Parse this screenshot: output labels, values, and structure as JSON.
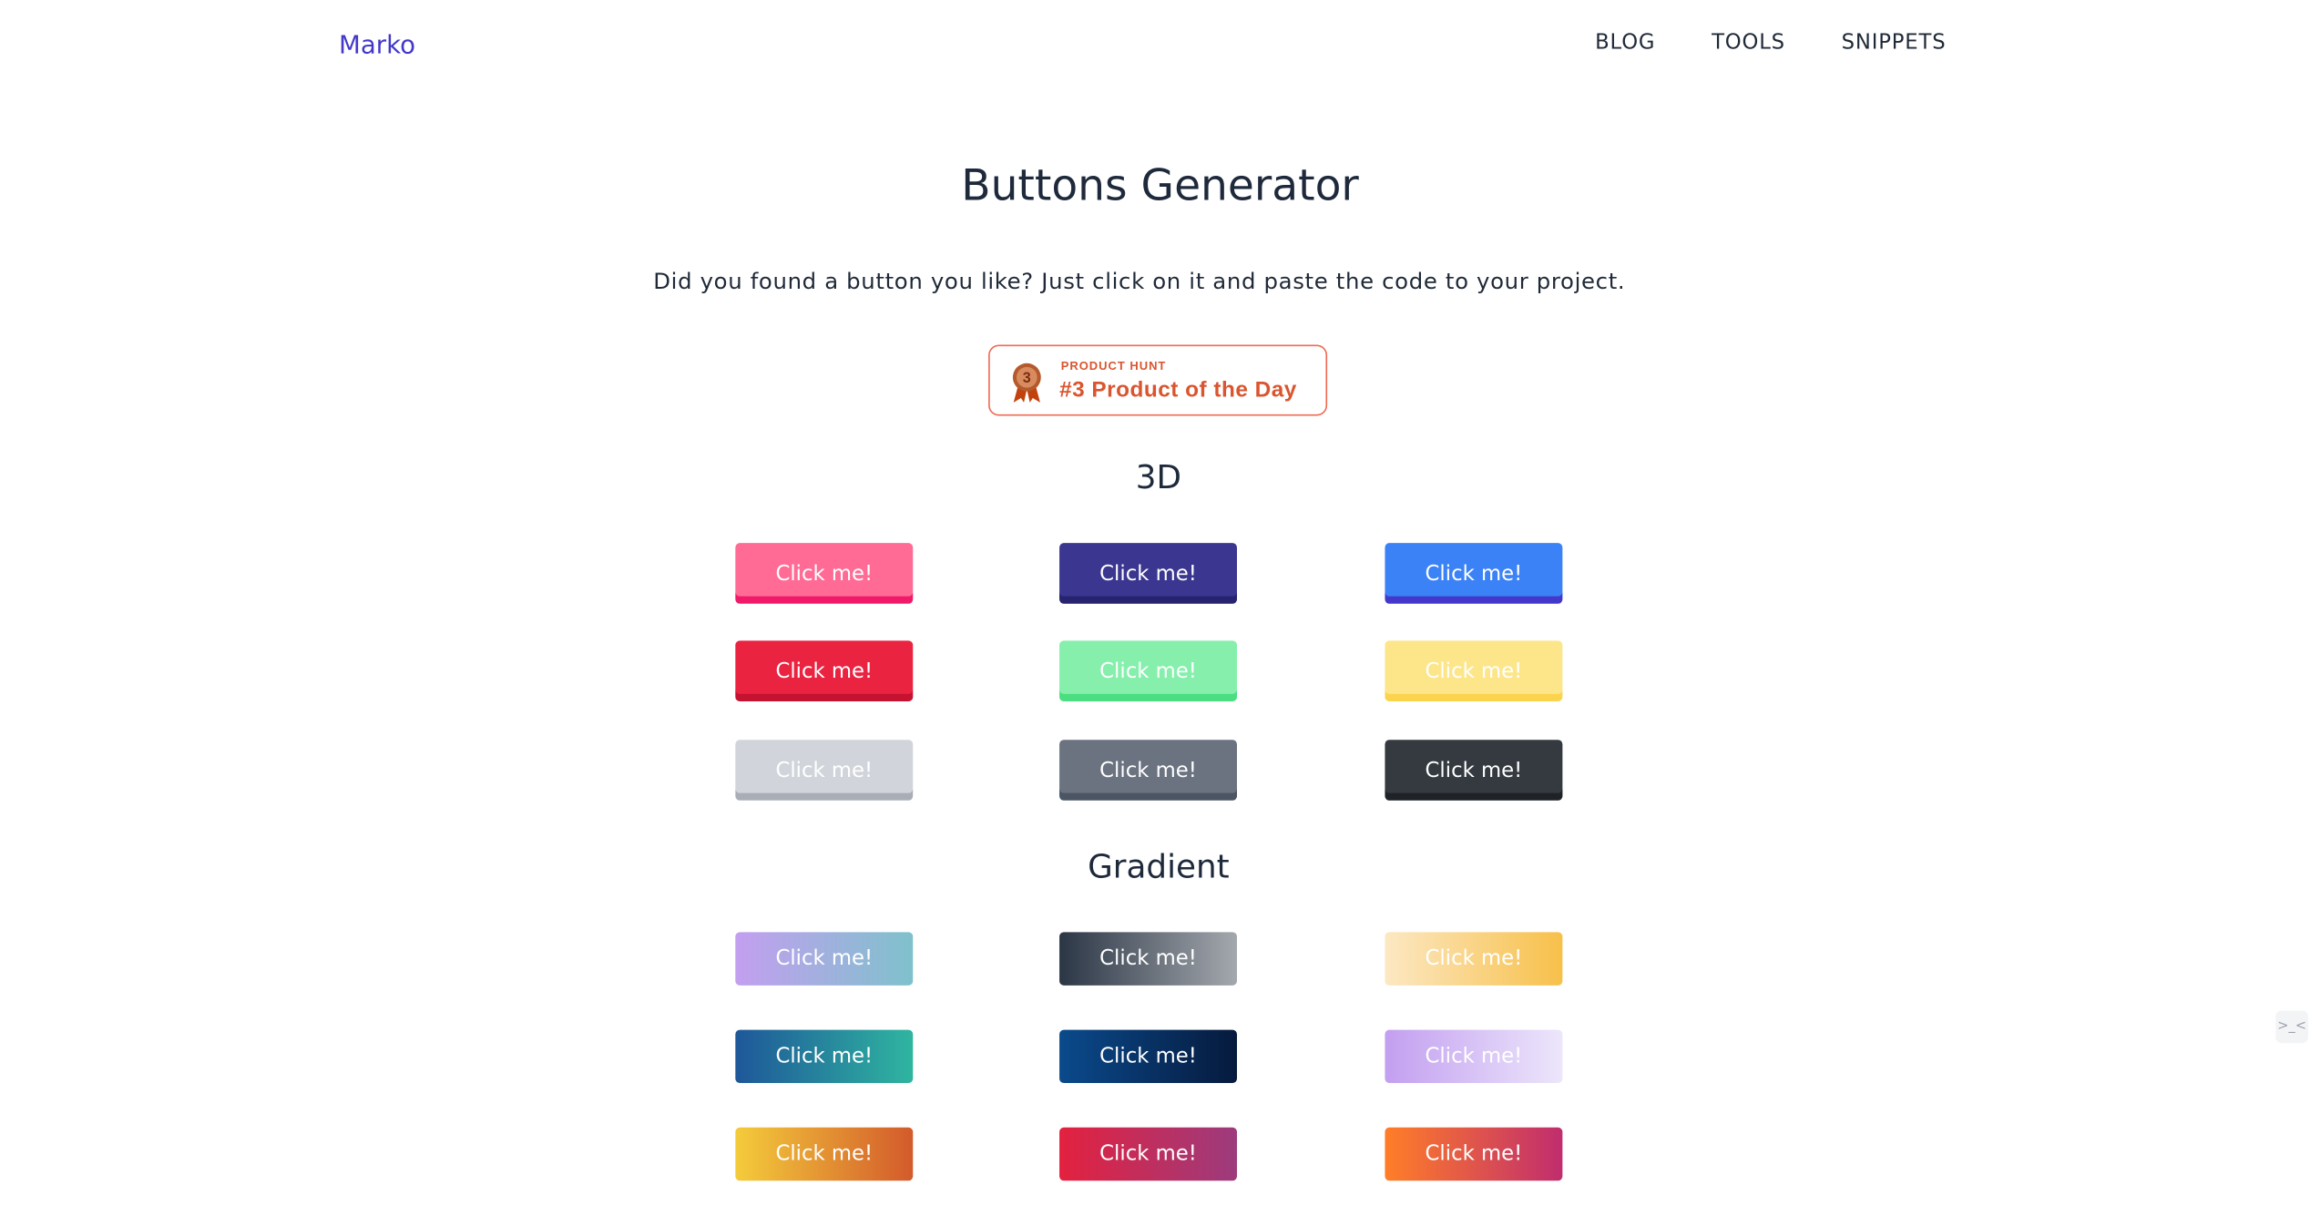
{
  "header": {
    "brand": "Marko",
    "nav": [
      "BLOG",
      "TOOLS",
      "SNIPPETS"
    ]
  },
  "main": {
    "title": "Buttons Generator",
    "subtitle": "Did you found a button you like? Just click on it and paste the code to your project.",
    "product_hunt_badge": {
      "rank": "3",
      "label_small": "PRODUCT HUNT",
      "label_big": "#3 Product of the Day",
      "color": "#da552f"
    }
  },
  "sections": [
    {
      "title": "3D",
      "button_label": "Click me!",
      "buttons": [
        {
          "style": "pink",
          "face": "#ff6b95",
          "edge": "#f0196a"
        },
        {
          "style": "indigo",
          "face": "#3b3690",
          "edge": "#27236e"
        },
        {
          "style": "blue",
          "face": "#3b82f6",
          "edge": "#4338ca"
        },
        {
          "style": "red",
          "face": "#ea2340",
          "edge": "#c41230"
        },
        {
          "style": "green",
          "face": "#86efac",
          "edge": "#4ade80"
        },
        {
          "style": "yellow",
          "face": "#fde68a",
          "edge": "#fcd34d"
        },
        {
          "style": "light-gray",
          "face": "#d1d5db",
          "edge": "#a9aeb6"
        },
        {
          "style": "gray",
          "face": "#6b7280",
          "edge": "#4b5563"
        },
        {
          "style": "dark",
          "face": "#343a40",
          "edge": "#1f2327"
        }
      ]
    },
    {
      "title": "Gradient",
      "button_label": "Click me!",
      "buttons": [
        {
          "style": "lavender-teal",
          "from": "#c39ff0",
          "to": "#7fc1cc"
        },
        {
          "style": "slate-silver",
          "from": "#2b3645",
          "to": "#a4a8ae"
        },
        {
          "style": "cream-amber",
          "from": "#fce8c3",
          "to": "#f7c04a"
        },
        {
          "style": "navy-teal",
          "from": "#1e5799",
          "to": "#2fb5a0"
        },
        {
          "style": "ocean-deep",
          "from": "#0a4a8c",
          "to": "#061a3d"
        },
        {
          "style": "lilac-mist",
          "from": "#c39ff0",
          "to": "#ece6fb"
        },
        {
          "style": "gold-rust",
          "from": "#f4cc3b",
          "to": "#d35a2b"
        },
        {
          "style": "crimson-plum",
          "from": "#e3213f",
          "to": "#9c3b7d"
        },
        {
          "style": "sunset",
          "from": "#ff7e28",
          "to": "#c02d6e"
        }
      ]
    }
  ]
}
